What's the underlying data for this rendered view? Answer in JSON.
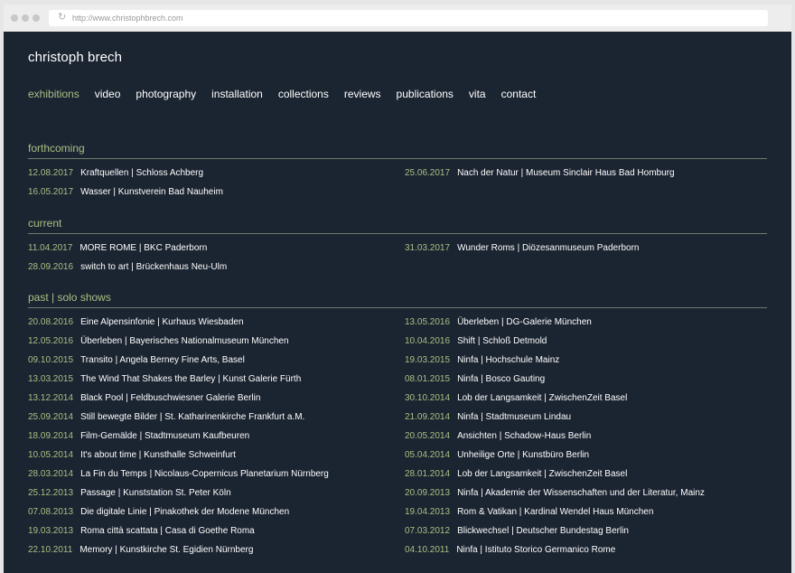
{
  "browser": {
    "url": "http://www.christophbrech.com"
  },
  "site": {
    "title": "christoph brech"
  },
  "nav": [
    {
      "label": "exhibitions",
      "active": true
    },
    {
      "label": "video"
    },
    {
      "label": "photography"
    },
    {
      "label": "installation"
    },
    {
      "label": "collections"
    },
    {
      "label": "reviews"
    },
    {
      "label": "publications"
    },
    {
      "label": "vita"
    },
    {
      "label": "contact"
    }
  ],
  "sections": [
    {
      "heading": "forthcoming",
      "left": [
        {
          "date": "12.08.2017",
          "title": "Kraftquellen | Schloss Achberg"
        },
        {
          "date": "16.05.2017",
          "title": "Wasser | Kunstverein Bad Nauheim"
        }
      ],
      "right": [
        {
          "date": "25.06.2017",
          "title": "Nach der Natur | Museum Sinclair Haus Bad Homburg"
        }
      ]
    },
    {
      "heading": "current",
      "left": [
        {
          "date": "11.04.2017",
          "title": "MORE ROME | BKC Paderborn"
        },
        {
          "date": "28.09.2016",
          "title": "switch to art | Brückenhaus Neu-Ulm"
        }
      ],
      "right": [
        {
          "date": "31.03.2017",
          "title": "Wunder Roms | Diözesanmuseum Paderborn"
        }
      ]
    },
    {
      "heading": "past | solo shows",
      "left": [
        {
          "date": "20.08.2016",
          "title": "Eine Alpensinfonie | Kurhaus Wiesbaden"
        },
        {
          "date": "12.05.2016",
          "title": "Überleben | Bayerisches Nationalmuseum München"
        },
        {
          "date": "09.10.2015",
          "title": "Transito | Angela Berney Fine Arts, Basel"
        },
        {
          "date": "13.03.2015",
          "title": "The Wind That Shakes the Barley | Kunst Galerie Fürth"
        },
        {
          "date": "13.12.2014",
          "title": "Black Pool | Feldbuschwiesner Galerie Berlin"
        },
        {
          "date": "25.09.2014",
          "title": "Still bewegte Bilder | St. Katharinenkirche Frankfurt a.M."
        },
        {
          "date": "18.09.2014",
          "title": "Film-Gemälde | Stadtmuseum Kaufbeuren"
        },
        {
          "date": "10.05.2014",
          "title": "It's about time | Kunsthalle Schweinfurt"
        },
        {
          "date": "28.03.2014",
          "title": "La Fin du Temps | Nicolaus-Copernicus Planetarium Nürnberg"
        },
        {
          "date": "25.12.2013",
          "title": "Passage | Kunststation St. Peter Köln"
        },
        {
          "date": "07.08.2013",
          "title": "Die digitale Linie | Pinakothek der Modene München"
        },
        {
          "date": "19.03.2013",
          "title": "Roma città scattata | Casa di Goethe Roma"
        },
        {
          "date": "22.10.2011",
          "title": "Memory | Kunstkirche St. Egidien Nürnberg"
        }
      ],
      "right": [
        {
          "date": "13.05.2016",
          "title": "Überleben | DG-Galerie München"
        },
        {
          "date": "10.04.2016",
          "title": "Shift | Schloß Detmold"
        },
        {
          "date": "19.03.2015",
          "title": "Ninfa | Hochschule Mainz"
        },
        {
          "date": "08.01.2015",
          "title": "Ninfa | Bosco Gauting"
        },
        {
          "date": "30.10.2014",
          "title": "Lob der Langsamkeit | ZwischenZeit Basel"
        },
        {
          "date": "21.09.2014",
          "title": "Ninfa | Stadtmuseum Lindau"
        },
        {
          "date": "20.05.2014",
          "title": "Ansichten | Schadow-Haus Berlin"
        },
        {
          "date": "05.04.2014",
          "title": "Unheilige Orte | Kunstbüro Berlin"
        },
        {
          "date": "28.01.2014",
          "title": "Lob der Langsamkeit | ZwischenZeit Basel"
        },
        {
          "date": "20.09.2013",
          "title": "Ninfa | Akademie der Wissenschaften und der Literatur, Mainz"
        },
        {
          "date": "19.04.2013",
          "title": "Rom & Vatikan | Kardinal Wendel Haus München"
        },
        {
          "date": "07.03.2012",
          "title": "Blickwechsel | Deutscher Bundestag Berlin"
        },
        {
          "date": "04.10.2011",
          "title": "Ninfa | Istituto Storico Germanico Rome"
        }
      ]
    }
  ]
}
